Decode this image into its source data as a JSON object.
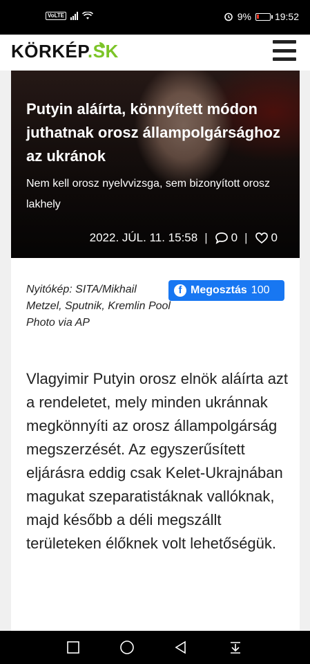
{
  "status_bar": {
    "volte": "VoLTE",
    "battery_pct": "9%",
    "time": "19:52",
    "icons": [
      "signal-icon",
      "wifi-icon",
      "alarm-icon",
      "battery-icon"
    ]
  },
  "header": {
    "logo_main": "KÖRKÉP",
    "logo_suffix": ".SK",
    "menu_icon": "hamburger-menu-icon",
    "brand_color": "#7cc428"
  },
  "hero": {
    "title": "Putyin aláírta, könnyített módon juthatnak orosz állampolgársághoz az ukránok",
    "subtitle": "Nem kell orosz nyelvvizsga, sem bizonyított orosz lakhely",
    "date": "2022. JÚL. 11. 15:58",
    "comments": "0",
    "likes": "0",
    "separator": "|"
  },
  "article": {
    "photo_credit": "Nyitókép: SITA/Mikhail Metzel, Sputnik, Kremlin Pool Photo via AP",
    "share_label": "Megosztás",
    "share_count": "100",
    "share_color": "#1877f2",
    "lead": "Vlagyimir Putyin orosz elnök aláírta azt a rendeletet, mely minden ukránnak megkönnyíti az orosz állampolgárság megszerzését. Az egyszerűsített eljárásra eddig csak Kelet-Ukrajnában magukat szeparatistáknak vallóknak, majd később a déli megszállt területeken élőknek volt lehetőségük."
  },
  "nav_bar": {
    "buttons": [
      "recents-square-icon",
      "home-circle-icon",
      "back-triangle-icon",
      "notification-pull-icon"
    ]
  }
}
